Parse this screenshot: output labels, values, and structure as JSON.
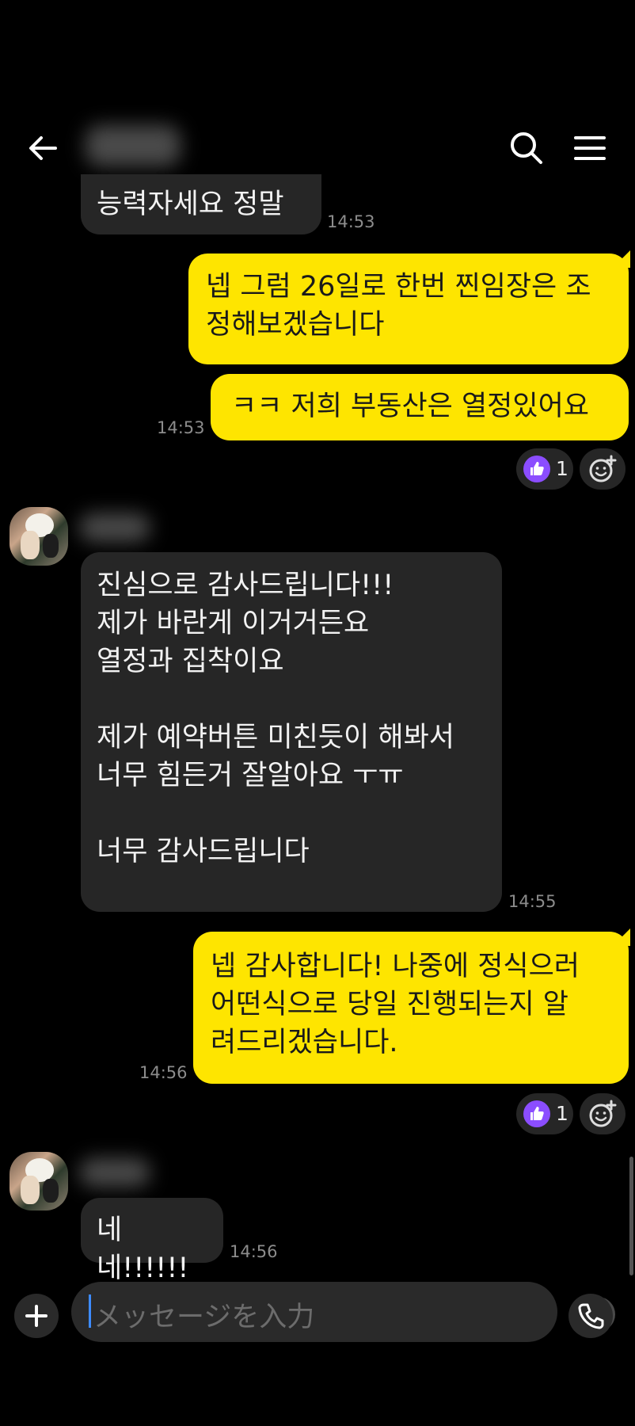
{
  "header": {
    "contact_name": "",
    "back_icon": "arrow-left-icon",
    "search_icon": "search-icon",
    "menu_icon": "menu-icon"
  },
  "messages": [
    {
      "side": "in",
      "text": "능력자세요 정말",
      "time": "14:53"
    },
    {
      "side": "out",
      "text": "넵 그럼 26일로 한번 찐임장은 조\n정해보겠습니다",
      "time": ""
    },
    {
      "side": "out",
      "text": "ㅋㅋ 저희 부동산은 열정있어요",
      "time": "14:53",
      "reaction_count": "1"
    },
    {
      "side": "in",
      "text": "진심으로 감사드립니다!!!\n제가 바란게 이거거든요\n열정과 집착이요\n\n제가 예약버튼 미친듯이 해봐서\n너무 힘든거 잘알아요 ㅜㅠ\n\n너무 감사드립니다",
      "time": "14:55"
    },
    {
      "side": "out",
      "text": "넵 감사합니다! 나중에 정식으러\n어떤식으로 당일 진행되는지 알\n려드리겠습니다.",
      "time": "14:56",
      "reaction_count": "1"
    },
    {
      "side": "in",
      "text": "네네!!!!!!",
      "time": "14:56"
    }
  ],
  "composer": {
    "placeholder": "メッセージを入力",
    "plus_icon": "plus-icon",
    "emoji_icon": "emoji-icon",
    "call_icon": "phone-icon"
  },
  "colors": {
    "background": "#000000",
    "outgoing_bubble": "#fee500",
    "incoming_bubble": "#262626",
    "reaction_purple": "#8b4dff"
  }
}
